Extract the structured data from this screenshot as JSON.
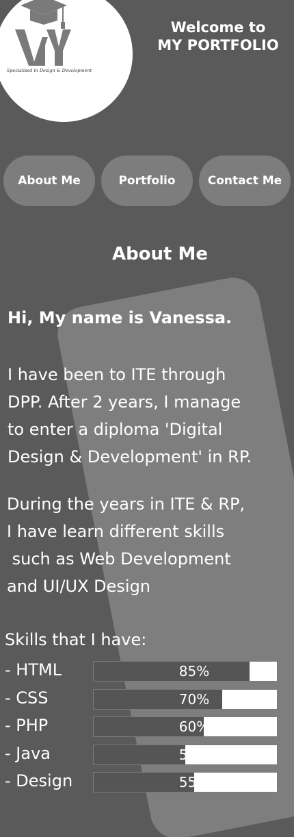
{
  "header": {
    "welcome_line1": "Welcome to",
    "welcome_line2": "MY PORTFOLIO",
    "logo": {
      "letters": "VY",
      "tagline": "Specialised in Design & Development"
    }
  },
  "nav": {
    "about": "About Me",
    "portfolio": "Portfolio",
    "contact": "Contact Me"
  },
  "about": {
    "title": "About Me",
    "greeting": "Hi, My name is Vanessa.",
    "paragraph1": [
      "I have been to ITE through",
      "DPP. After 2 years, I manage",
      "to enter a diploma 'Digital",
      "Design & Development' in RP."
    ],
    "paragraph2": [
      "During the years in ITE & RP,",
      "I have learn different skills",
      " such as Web Development",
      "and UI/UX Design"
    ]
  },
  "skills": {
    "heading": "Skills that I have:",
    "items": [
      {
        "label": "- HTML",
        "percent": 85,
        "percent_label": "85%"
      },
      {
        "label": "- CSS",
        "percent": 70,
        "percent_label": "70%"
      },
      {
        "label": "- PHP",
        "percent": 60,
        "percent_label": "60%"
      },
      {
        "label": "- Java",
        "percent": 50,
        "percent_label": "50%"
      },
      {
        "label": "- Design",
        "percent": 55,
        "percent_label": "55%"
      }
    ]
  },
  "colors": {
    "page_background": "#5a5a5a",
    "card_background": "#7e7e7e",
    "nav_button": "#7d7d7d",
    "bar_fill": "#555555",
    "bar_track": "#ffffff",
    "text": "#ffffff"
  }
}
